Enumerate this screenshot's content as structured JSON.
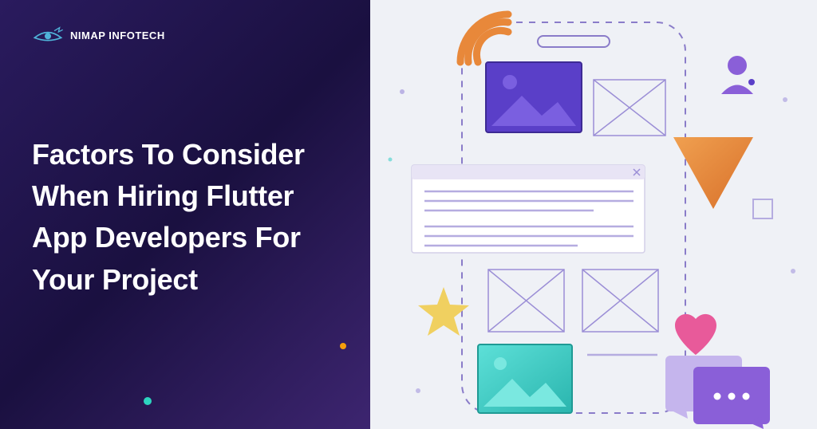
{
  "brand": {
    "name": "NIMAP INFOTECH"
  },
  "headline": "Factors To Consider When Hiring Flutter App Developers For Your Project",
  "colors": {
    "gradient_start": "#2a1b5e",
    "gradient_end": "#3d2570",
    "bg_right": "#eff1f6",
    "purple": "#5b3fc4",
    "purple_light": "#9b7de0",
    "orange": "#e8883a",
    "teal": "#3dd0c9",
    "yellow": "#f0d060",
    "pink": "#e85a9a"
  }
}
